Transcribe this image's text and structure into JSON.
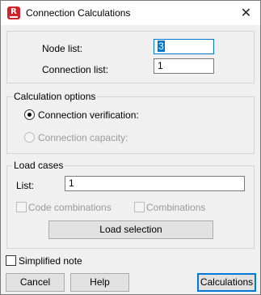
{
  "window": {
    "title": "Connection Calculations",
    "icon": "robot-app-icon",
    "icon_letter": "R",
    "close_glyph": "✕"
  },
  "node_list": {
    "label": "Node list:",
    "value": "3"
  },
  "connection_list": {
    "label": "Connection list:",
    "value": "1"
  },
  "calculation_options": {
    "title": "Calculation options",
    "verification": {
      "label": "Connection verification:",
      "selected": true,
      "enabled": true
    },
    "capacity": {
      "label": "Connection capacity:",
      "selected": false,
      "enabled": false
    }
  },
  "load_cases": {
    "title": "Load cases",
    "list_label": "List:",
    "list_value": "1",
    "code_combinations": {
      "label": "Code combinations",
      "checked": false,
      "enabled": false
    },
    "combinations": {
      "label": "Combinations",
      "checked": false,
      "enabled": false
    },
    "load_selection_button": "Load selection"
  },
  "simplified_note": {
    "label": "Simplified note",
    "checked": false
  },
  "buttons": {
    "cancel": "Cancel",
    "help": "Help",
    "calculations": "Calculations"
  },
  "colors": {
    "accent": "#0078d7",
    "app_icon": "#d3222a",
    "dialog_bg": "#f0f0f0"
  }
}
